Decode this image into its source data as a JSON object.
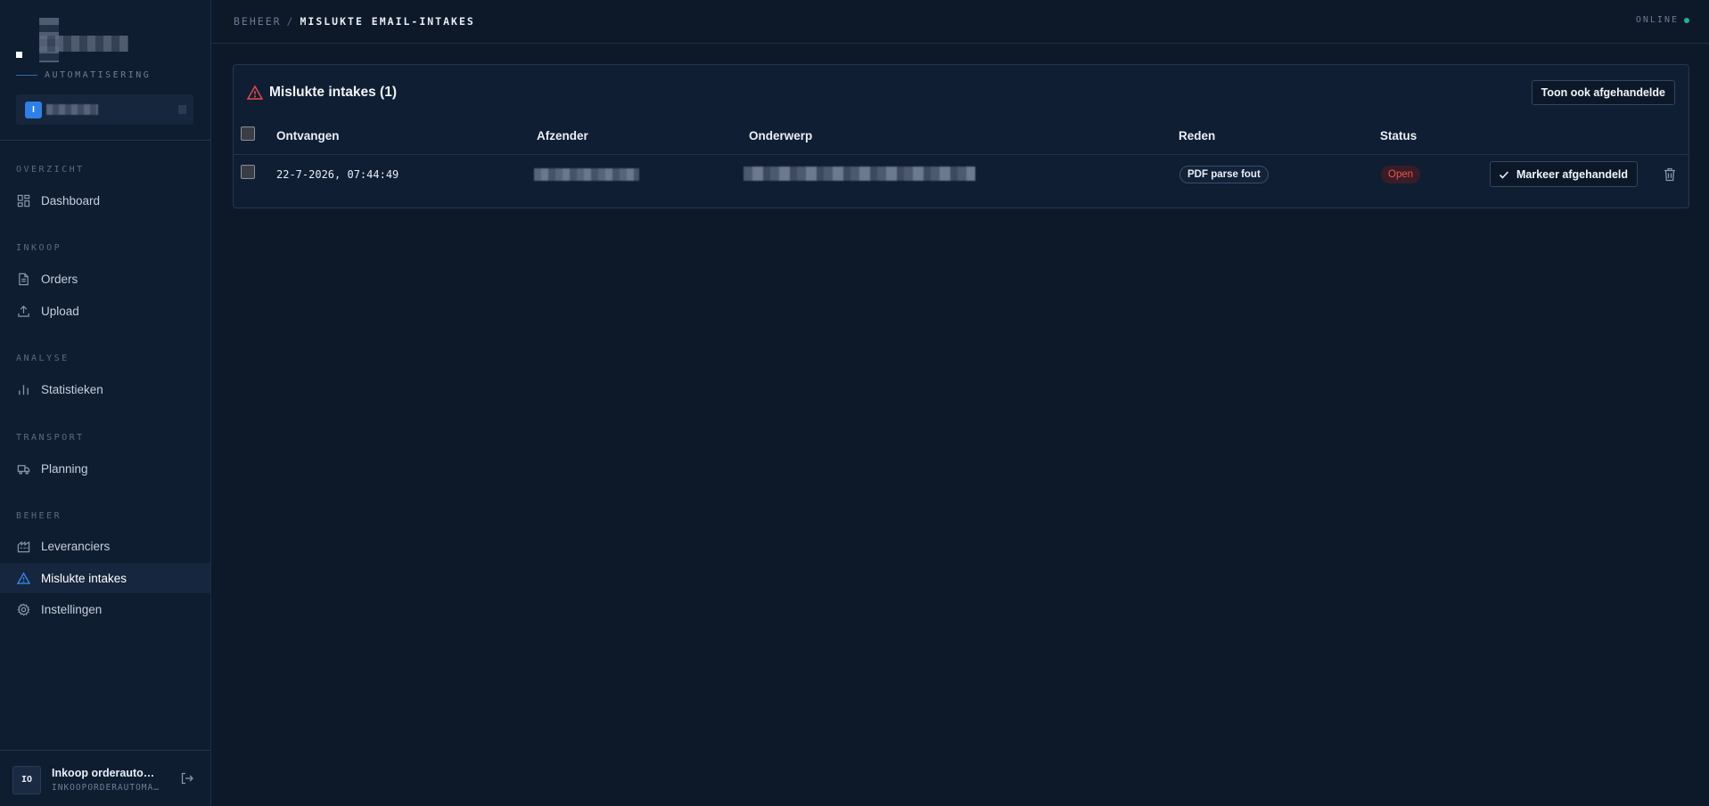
{
  "sidebar": {
    "subtitle": "AUTOMATISERING",
    "account_badge": "I",
    "sections": [
      {
        "label": "OVERZICHT",
        "items": [
          {
            "label": "Dashboard",
            "icon": "dashboard-icon"
          }
        ]
      },
      {
        "label": "INKOOP",
        "items": [
          {
            "label": "Orders",
            "icon": "document-icon"
          },
          {
            "label": "Upload",
            "icon": "upload-icon"
          }
        ]
      },
      {
        "label": "ANALYSE",
        "items": [
          {
            "label": "Statistieken",
            "icon": "bar-chart-icon"
          }
        ]
      },
      {
        "label": "TRANSPORT",
        "items": [
          {
            "label": "Planning",
            "icon": "truck-icon"
          }
        ]
      },
      {
        "label": "BEHEER",
        "items": [
          {
            "label": "Leveranciers",
            "icon": "building-icon"
          },
          {
            "label": "Mislukte intakes",
            "icon": "warning-icon",
            "active": true
          },
          {
            "label": "Instellingen",
            "icon": "gear-icon"
          }
        ]
      }
    ],
    "user": {
      "initials": "IO",
      "name": "Inkoop orderautoma…",
      "email": "INKOOPORDERAUTOMA…"
    }
  },
  "topbar": {
    "breadcrumb_parent": "BEHEER",
    "breadcrumb_separator": "/",
    "breadcrumb_current": "MISLUKTE EMAIL-INTAKES",
    "status": "ONLINE",
    "status_color": "#1fb48a"
  },
  "card": {
    "title": "Mislukte intakes (1)",
    "show_handled_label": "Toon ook afgehandelde",
    "columns": [
      "Ontvangen",
      "Afzender",
      "Onderwerp",
      "Reden",
      "Status"
    ],
    "rows": [
      {
        "received": "22-7-2026, 07:44:49",
        "reason": "PDF parse fout",
        "status": "Open",
        "mark_label": "Markeer afgehandeld"
      }
    ]
  },
  "colors": {
    "accent": "#2f7fe6",
    "warning": "#e5484d",
    "status_open": "#f0544f"
  }
}
